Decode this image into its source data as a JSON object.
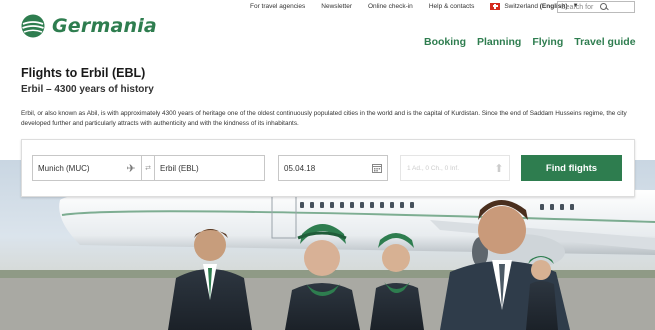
{
  "brand": {
    "name": "Germania",
    "color": "#2e7d4f"
  },
  "topbar": {
    "links": [
      "For travel agencies",
      "Newsletter",
      "Online check-in",
      "Help & contacts"
    ],
    "language_country": "Switzerland",
    "language_name": "(English)",
    "flag_icon": "swiss-flag-icon"
  },
  "search": {
    "placeholder": "Search for",
    "icon": "search-icon"
  },
  "mainnav": [
    "Booking",
    "Planning",
    "Flying",
    "Travel guide"
  ],
  "page": {
    "title": "Flights to Erbil (EBL)",
    "subtitle": "Erbil – 4300 years of history",
    "description": "Erbil, or also known as Abil, is with approximately 4300 years of heritage one of the oldest continuously populated cities in the world and is the capital of Kurdistan. Since the end of Saddam Husseins regime, the city developed further and particularly attracts with authenticity and with the kindness of its inhabitants."
  },
  "flight_form": {
    "from_value": "Munich (MUC)",
    "to_value": "Erbil (EBL)",
    "date_value": "05.04.18",
    "passengers_value": "1 Ad., 0 Ch., 0 Inf.",
    "find_label": "Find flights",
    "icons": [
      "plane-icon",
      "swap-icon",
      "calendar-icon",
      "passenger-icon"
    ]
  }
}
